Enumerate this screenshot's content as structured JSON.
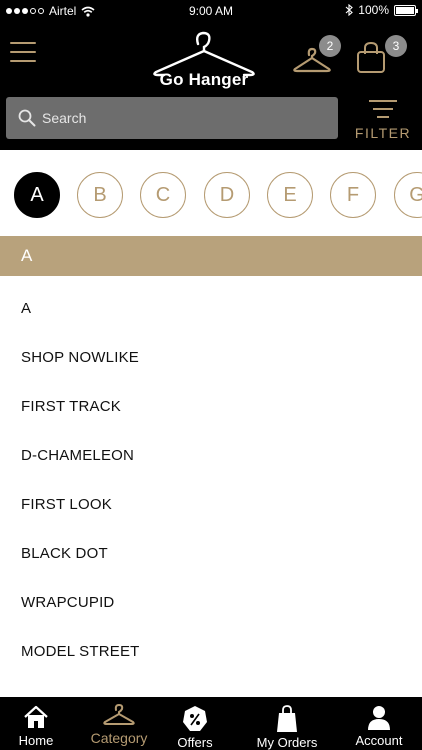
{
  "status_bar": {
    "carrier": "Airtel",
    "time": "9:00 AM",
    "battery": "100%"
  },
  "header": {
    "logo_text": "Go Hanger",
    "wishlist_count": "2",
    "cart_count": "3",
    "search_placeholder": "Search",
    "filter_label": "FILTER"
  },
  "alphabet": {
    "letters": [
      "A",
      "B",
      "C",
      "D",
      "E",
      "F",
      "G"
    ],
    "selected": "A"
  },
  "section": {
    "title": "A"
  },
  "brands": [
    "A",
    "SHOP NOWLIKE",
    "FIRST TRACK",
    "D-CHAMELEON",
    "FIRST LOOK",
    "BLACK DOT",
    "WRAPCUPID",
    "MODEL STREET"
  ],
  "tabs": [
    {
      "label": "Home",
      "icon": "home-icon"
    },
    {
      "label": "Category",
      "icon": "hanger-icon",
      "active": true
    },
    {
      "label": "Offers",
      "icon": "offer-tag-icon"
    },
    {
      "label": "My Orders",
      "icon": "shopping-bag-icon"
    },
    {
      "label": "Account",
      "icon": "user-icon"
    }
  ],
  "colors": {
    "accent": "#b59b72",
    "section_bg": "#b8a27c",
    "header_bg": "#000000"
  }
}
